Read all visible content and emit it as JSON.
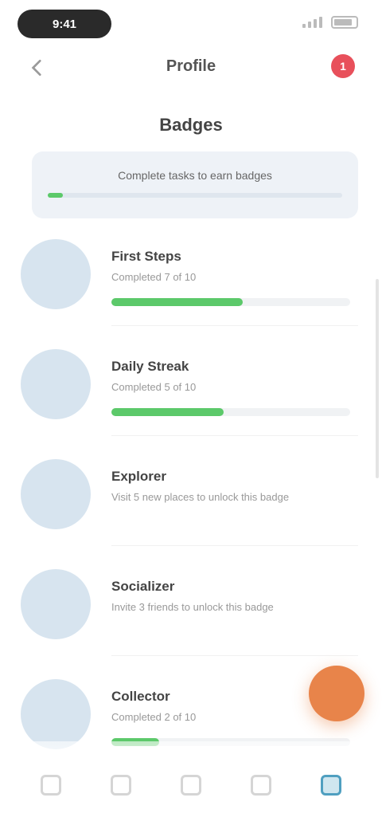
{
  "status_bar": {
    "time": "9:41"
  },
  "header": {
    "title": "Profile",
    "notification_count": "1"
  },
  "section_title": "Badges",
  "banner": {
    "text": "Complete tasks to earn badges",
    "progress": 0.05
  },
  "list": {
    "items": [
      {
        "title": "First Steps",
        "subtitle": "Completed 7 of 10",
        "progress": 0.55
      },
      {
        "title": "Daily Streak",
        "subtitle": "Completed 5 of 10",
        "progress": 0.47
      },
      {
        "title": "Explorer",
        "subtitle": "Visit 5 new places to unlock this badge",
        "progress": 0
      },
      {
        "title": "Socializer",
        "subtitle": "Invite 3 friends to unlock this badge",
        "progress": 0
      },
      {
        "title": "Collector",
        "subtitle": "Completed 2 of 10",
        "progress": 0.2
      }
    ]
  },
  "colors": {
    "accent": "#5cc96a",
    "fab": "#e8844a",
    "nav_active": "#4f9fc0",
    "avatar_bg": "#d7e4ef"
  },
  "bottom_nav": {
    "items": [
      {
        "icon": "home-icon"
      },
      {
        "icon": "search-icon"
      },
      {
        "icon": "calendar-icon"
      },
      {
        "icon": "chat-icon"
      },
      {
        "icon": "profile-icon",
        "active": true
      }
    ]
  }
}
